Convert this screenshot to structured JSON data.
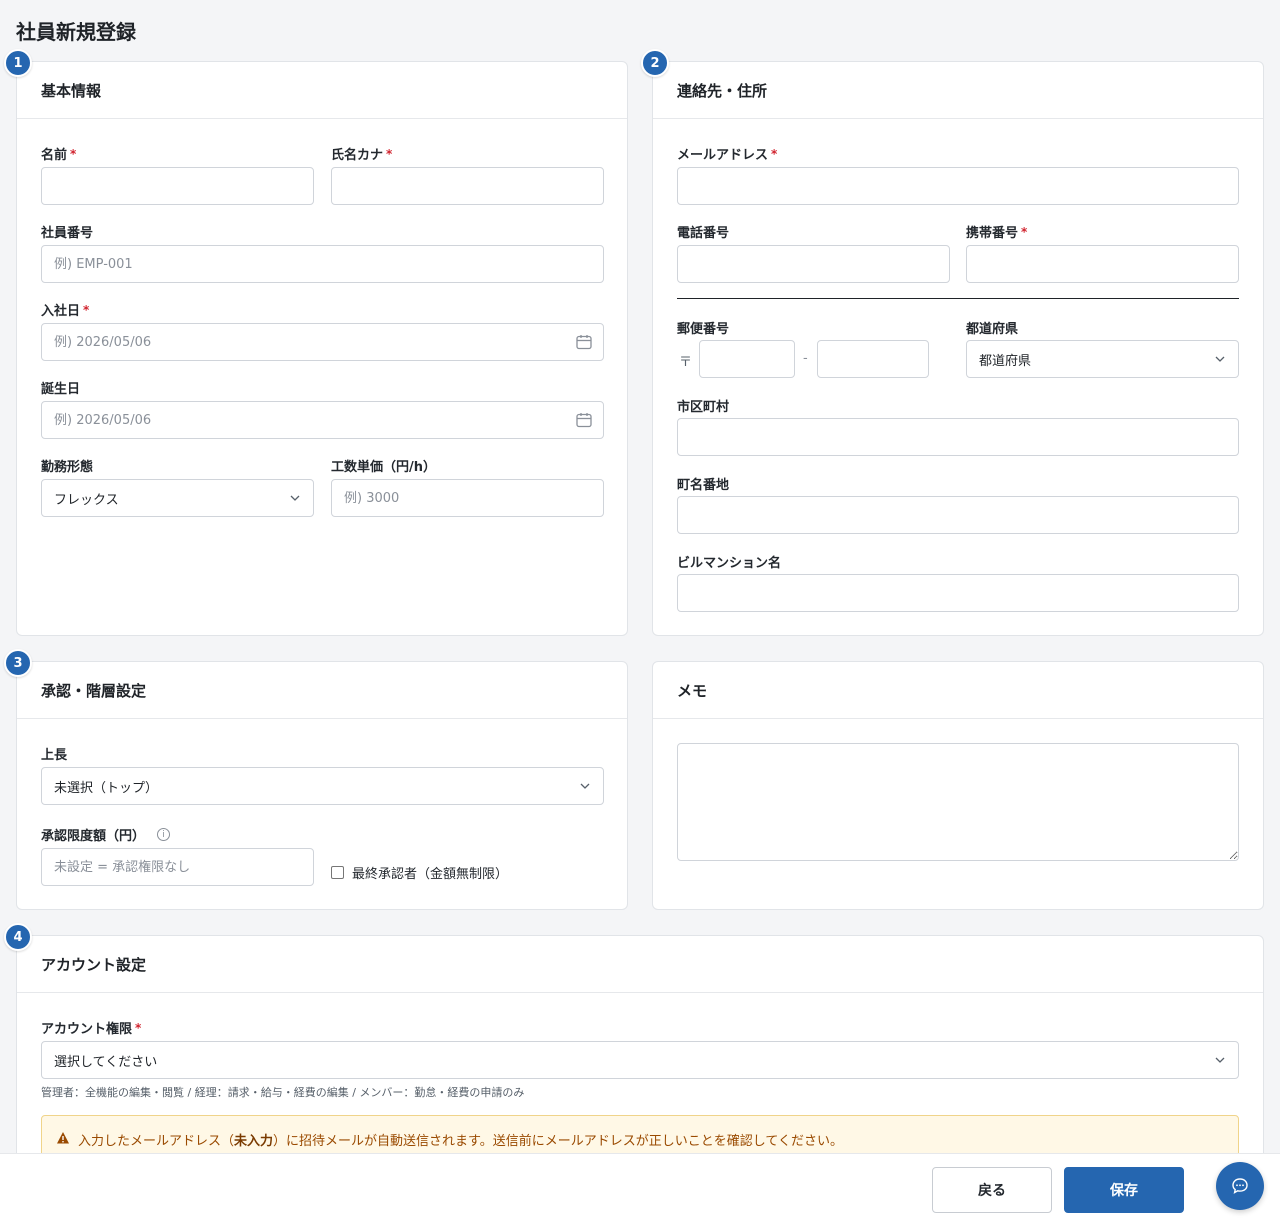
{
  "page": {
    "title": "社員新規登録"
  },
  "sections": {
    "basic": {
      "number": "1",
      "title": "基本情報",
      "name_label": "名前",
      "kana_label": "氏名カナ",
      "employee_no_label": "社員番号",
      "employee_no_placeholder": "例) EMP-001",
      "join_date_label": "入社日",
      "join_date_placeholder": "例) 2026/05/06",
      "birthday_label": "誕生日",
      "birthday_placeholder": "例) 2026/05/06",
      "work_style_label": "勤務形態",
      "work_style_value": "フレックス",
      "unit_price_label": "工数単価（円/h）",
      "unit_price_placeholder": "例) 3000"
    },
    "contact": {
      "number": "2",
      "title": "連絡先・住所",
      "email_label": "メールアドレス",
      "phone_label": "電話番号",
      "mobile_label": "携帯番号",
      "zip_label": "郵便番号",
      "zip_mark": "〒",
      "zip_separator": "-",
      "prefecture_label": "都道府県",
      "prefecture_value": "都道府県",
      "city_label": "市区町村",
      "street_label": "町名番地",
      "building_label": "ビルマンション名"
    },
    "approval": {
      "number": "3",
      "title": "承認・階層設定",
      "boss_label": "上長",
      "boss_value": "未選択（トップ）",
      "limit_label": "承認限度額（円）",
      "limit_info_icon": "i",
      "limit_placeholder": "未設定 = 承認権限なし",
      "final_approver_label": "最終承認者（金額無制限）"
    },
    "memo": {
      "title": "メモ"
    },
    "account": {
      "number": "4",
      "title": "アカウント設定",
      "role_label": "アカウント権限",
      "role_value": "選択してください",
      "role_hint": "管理者：全機能の編集・閲覧 / 経理：請求・給与・経費の編集 / メンバー：勤怠・経費の申請のみ",
      "alert_prefix": "入力したメールアドレス（",
      "alert_strong": "未入力",
      "alert_suffix": "）に招待メールが自動送信されます。送信前にメールアドレスが正しいことを確認してください。"
    }
  },
  "required_mark": "*",
  "footer": {
    "back_label": "戻る",
    "save_label": "保存"
  },
  "colors": {
    "accent": "#2566b0",
    "required": "#d1242f",
    "warning_bg": "#fff8e6",
    "warning_text": "#9a4a00"
  }
}
